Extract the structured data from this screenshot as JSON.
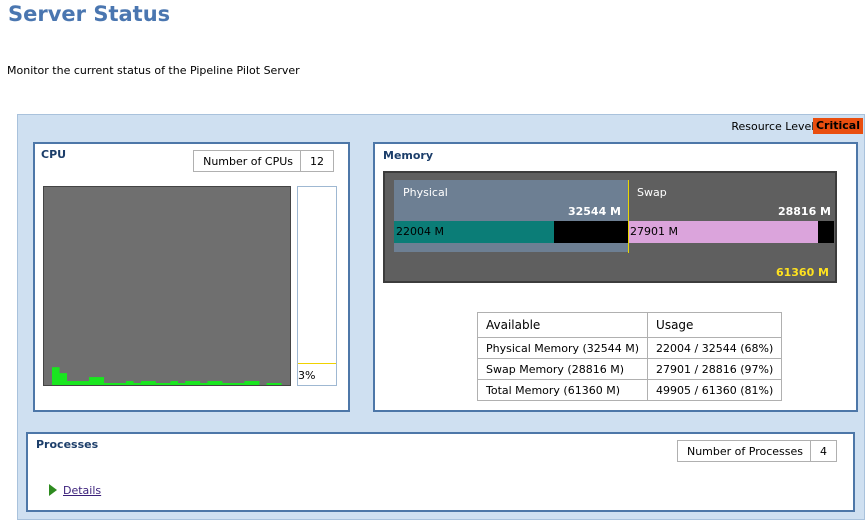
{
  "page": {
    "title": "Server Status",
    "description": "Monitor the current status of the Pipeline Pilot Server"
  },
  "resource": {
    "label": "Resource Level:",
    "level": "Critical",
    "level_color": "#e94e0f"
  },
  "cpu": {
    "title": "CPU",
    "count_label": "Number of CPUs",
    "count": "12",
    "usage_percent": 3,
    "usage_label": "3%",
    "history_percent": [
      9,
      6,
      2,
      2,
      2,
      4,
      4,
      1,
      1,
      1,
      2,
      1,
      2,
      2,
      1,
      1,
      2,
      1,
      2,
      2,
      1,
      2,
      2,
      1,
      1,
      1,
      2,
      2,
      0,
      1,
      1
    ],
    "graph_color": "#6f6f6f",
    "bar_color": "#19e61f"
  },
  "memory": {
    "title": "Memory",
    "physical_label": "Physical",
    "physical_total": "32544 M",
    "physical_used": "22004 M",
    "physical_used_percent": 68,
    "swap_label": "Swap",
    "swap_total": "28816 M",
    "swap_used": "27901 M",
    "swap_used_percent": 97,
    "grand_total": "61360 M",
    "table": {
      "headers": [
        "Available",
        "Usage"
      ],
      "rows": [
        [
          "Physical Memory (32544 M)",
          "22004 / 32544 (68%)"
        ],
        [
          "Swap Memory (28816 M)",
          "27901 / 28816 (97%)"
        ],
        [
          "Total Memory (61360 M)",
          "49905 / 61360 (81%)"
        ]
      ]
    }
  },
  "processes": {
    "title": "Processes",
    "count_label": "Number of Processes",
    "count": "4",
    "details_label": "Details"
  }
}
